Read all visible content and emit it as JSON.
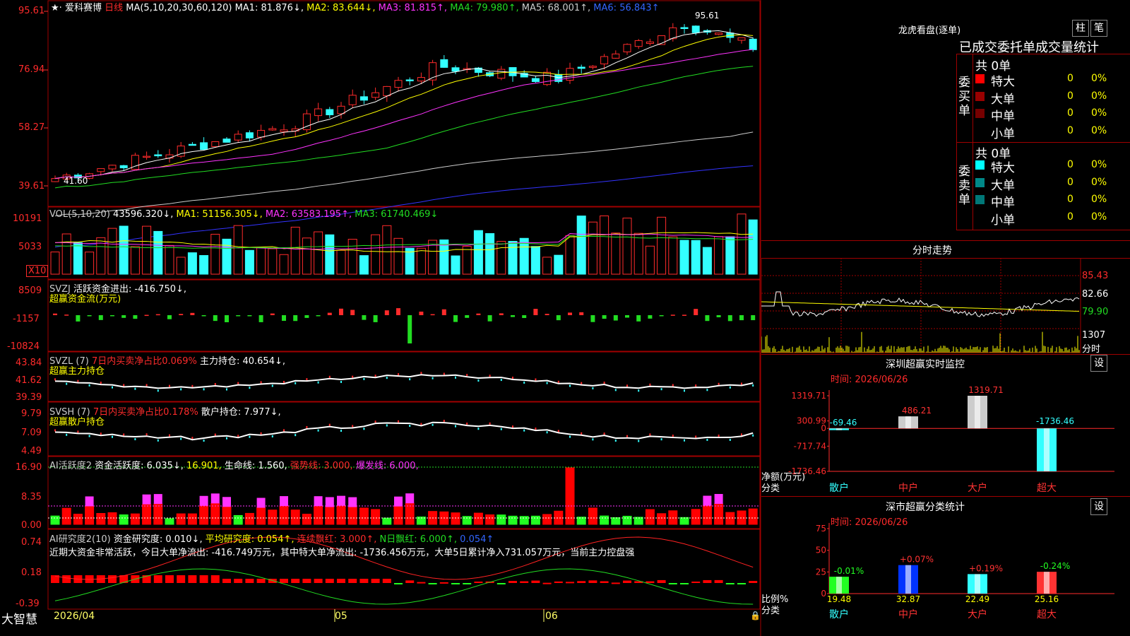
{
  "app": {
    "name": "大智慧",
    "date_label": "2026/04",
    "month_05": "05",
    "month_06": "06"
  },
  "kline": {
    "stock": "爱科赛博",
    "period": "日线",
    "ma_def": "MA(5,10,20,30,60,120)",
    "ma1": "MA1: 81.876↓,",
    "ma2": "MA2: 83.644↓,",
    "ma3": "MA3: 81.815↑,",
    "ma4": "MA4: 79.980↑,",
    "ma5": "MA5: 68.001↑,",
    "ma6": "MA6: 56.843↑",
    "y_ticks": [
      "95.61",
      "76.94",
      "58.27",
      "39.61"
    ],
    "high_label": "95.61",
    "low_label": "41.60",
    "colors": {
      "ma1": "#ffffff",
      "ma2": "#ffff00",
      "ma3": "#ff33ff",
      "ma4": "#22dd22",
      "ma5": "#cccccc",
      "ma6": "#3333ff"
    }
  },
  "vol": {
    "title": "VOL(5,10,20)",
    "value": "43596.320↓,",
    "ma1": "MA1: 51156.305↓,",
    "ma2": "MA2: 63583.195↑,",
    "ma3": "MA3: 61740.469↓",
    "y_ticks": [
      "10191",
      "5033"
    ],
    "unit": "X10"
  },
  "svzj": {
    "title": "SVZJ",
    "label": "活跃资金进出: -416.750↓,",
    "sub": "超赢资金流(万元)",
    "y_ticks": [
      "8509",
      "-1157",
      "-10824"
    ]
  },
  "svzl": {
    "title": "SVZL (7)",
    "ratio": "7日内买卖净占比0.069%",
    "hold": "主力持仓: 40.654↓,",
    "sub": "超赢主力持仓",
    "y_ticks": [
      "43.84",
      "41.62",
      "39.39"
    ]
  },
  "svsh": {
    "title": "SVSH (7)",
    "ratio": "7日内买卖净占比0.178%",
    "hold": "散户持仓: 7.977↓,",
    "sub": "超赢散户持仓",
    "y_ticks": [
      "9.79",
      "7.09",
      "4.49"
    ]
  },
  "ai1": {
    "title": "AI活跃度2",
    "act": "资金活跃度: 6.035↓,",
    "v2": "16.901,",
    "life": "生命线: 1.560,",
    "strong": "强势线: 3.000,",
    "burst": "爆发线: 6.000,",
    "y_ticks": [
      "16.90",
      "8.35",
      "0.00"
    ]
  },
  "ai2": {
    "title": "AI研究度2(10)",
    "research": "资金研究度: 0.010↓,",
    "avg": "平均研究度: 0.054↑,",
    "lianxu": "连续飘红: 3.000↑,",
    "nday": "N日飘红: 6.000↑,",
    "last": "0.054↑",
    "comment": "近期大资金非常活跃，今日大单净流出: -416.749万元，其中特大单净流出: -1736.456万元，大单5日累计净入731.057万元，当前主力控盘强",
    "y_ticks": [
      "0.74",
      "0.18",
      "-0.39"
    ]
  },
  "right": {
    "lhb_title": "龙虎看盘(逐单)",
    "btn_zhu": "柱",
    "btn_bi": "笔",
    "tab_text": "已成交委托单成交量统计",
    "buy_side": "委买单",
    "sell_side": "委卖单",
    "buy_total": "共 0单",
    "sell_total": "共 0单",
    "rows": [
      {
        "label": "特大",
        "n": "0",
        "pct": "0%"
      },
      {
        "label": "大单",
        "n": "0",
        "pct": "0%"
      },
      {
        "label": "中单",
        "n": "0",
        "pct": "0%"
      },
      {
        "label": "小单",
        "n": "0",
        "pct": "0%"
      }
    ],
    "buy_colors": [
      "#ff0000",
      "#990000",
      "#770000",
      "#000000"
    ],
    "sell_colors": [
      "#00ffff",
      "#008888",
      "#007777",
      "#000000"
    ],
    "fenshi_title": "分时走势",
    "fenshi_y": [
      "85.43",
      "82.66",
      "79.90"
    ],
    "fenshi_vol": "1307",
    "fenshi_unit": "分时",
    "monitor_title": "深圳超赢实时监控",
    "set": "设",
    "monitor_time": "时间: 2026/06/26",
    "monitor_y": [
      "1319.71",
      "300.99",
      "0",
      "-717.74",
      "-1736.46"
    ],
    "monitor_axis_label1": "净额(万元)",
    "monitor_axis_label2": "分类",
    "class_stat_title": "深市超赢分类统计",
    "class_time": "时间: 2026/06/26",
    "class_y": [
      "75",
      "50",
      "25",
      "0"
    ],
    "class_axis_label1": "比例%",
    "class_axis_label2": "分类",
    "categories": [
      "散户",
      "中户",
      "大户",
      "超大"
    ]
  },
  "chart_data": [
    {
      "type": "bar",
      "title": "深圳超赢实时监控",
      "categories": [
        "散户",
        "中户",
        "大户",
        "超大"
      ],
      "values": [
        -69.46,
        486.21,
        1319.71,
        -1736.46
      ],
      "value_labels": [
        "-69.46",
        "486.21",
        "1319.71",
        "-1736.46"
      ],
      "ylabel": "净额(万元)",
      "ylim": [
        -1736.46,
        1319.71
      ]
    },
    {
      "type": "bar",
      "title": "深市超赢分类统计",
      "categories": [
        "散户",
        "中户",
        "大户",
        "超大"
      ],
      "values": [
        19.48,
        32.87,
        22.49,
        25.16
      ],
      "value_labels": [
        "19.48",
        "32.87",
        "22.49",
        "25.16"
      ],
      "changes": [
        "-0.01%",
        "+0.07%",
        "+0.19%",
        "-0.24%"
      ],
      "ylabel": "比例%",
      "ylim": [
        0,
        75
      ]
    }
  ]
}
